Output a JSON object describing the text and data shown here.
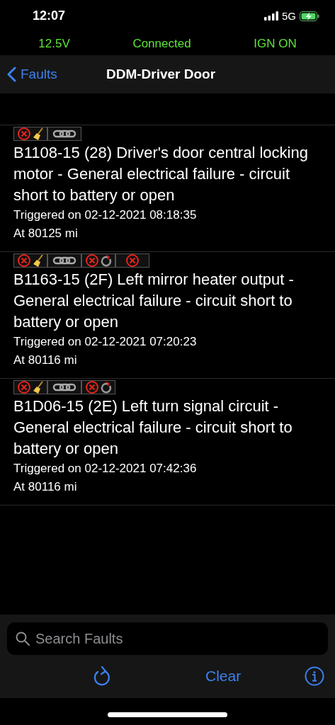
{
  "status_bar": {
    "time": "12:07",
    "network": "5G"
  },
  "info_bar": {
    "voltage": "12.5V",
    "connection": "Connected",
    "ignition": "IGN ON"
  },
  "nav": {
    "back": "Faults",
    "title": "DDM-Driver Door"
  },
  "faults": [
    {
      "title": "B1108-15 (28) Driver's door central locking motor - General electrical failure - circuit short to battery or open",
      "triggered": "Triggered on 02-12-2021 08:18:35",
      "mileage": "At 80125 mi",
      "badges": [
        {
          "kind": "clearable"
        },
        {
          "kind": "linked"
        }
      ]
    },
    {
      "title": "B1163-15 (2F) Left mirror heater output - General electrical failure - circuit short to battery or open",
      "triggered": "Triggered on 02-12-2021 07:20:23",
      "mileage": "At 80116 mi",
      "badges": [
        {
          "kind": "clearable"
        },
        {
          "kind": "linked"
        },
        {
          "kind": "cycle"
        },
        {
          "kind": "failed"
        }
      ]
    },
    {
      "title": "B1D06-15 (2E) Left turn signal circuit - General electrical failure - circuit short to battery or open",
      "triggered": "Triggered on 02-12-2021 07:42:36",
      "mileage": "At 80116 mi",
      "badges": [
        {
          "kind": "clearable"
        },
        {
          "kind": "linked"
        },
        {
          "kind": "cycle"
        }
      ]
    }
  ],
  "search": {
    "placeholder": "Search Faults"
  },
  "toolbar": {
    "clear": "Clear"
  }
}
